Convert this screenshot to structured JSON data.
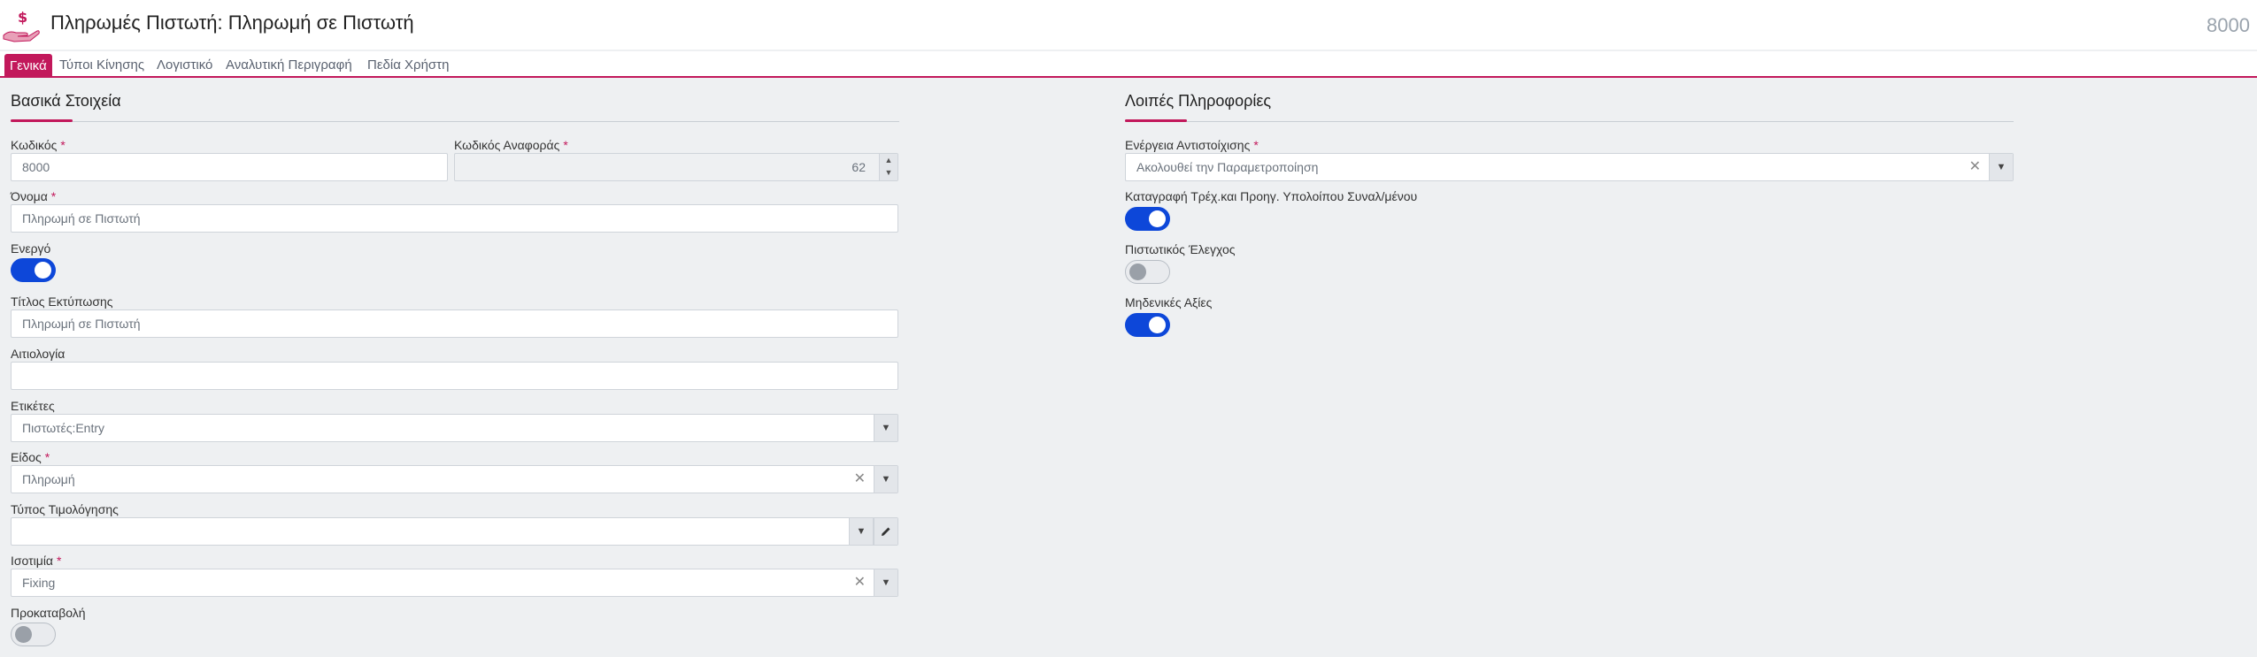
{
  "header": {
    "title": "Πληρωμές Πιστωτή: Πληρωμή σε Πιστωτή",
    "record_code": "8000",
    "icon": "hand-dollar-icon",
    "accent": "#c2185b"
  },
  "tabs": [
    {
      "label": "Γενικά",
      "active": true
    },
    {
      "label": "Τύποι Κίνησης",
      "active": false
    },
    {
      "label": "Λογιστικό",
      "active": false
    },
    {
      "label": "Αναλυτική Περιγραφή",
      "active": false
    },
    {
      "label": "Πεδία Χρήστη",
      "active": false
    }
  ],
  "basic": {
    "title": "Βασικά Στοιχεία",
    "code": {
      "label": "Κωδικός",
      "required": "*",
      "value": "8000"
    },
    "ref_code": {
      "label": "Κωδικός Αναφοράς",
      "required": "*",
      "value": "62"
    },
    "name": {
      "label": "Όνομα",
      "required": "*",
      "value": "Πληρωμή σε Πιστωτή"
    },
    "active": {
      "label": "Ενεργό",
      "on": true
    },
    "print_title": {
      "label": "Τίτλος Εκτύπωσης",
      "value": "Πληρωμή σε Πιστωτή"
    },
    "reason": {
      "label": "Αιτιολογία",
      "value": ""
    },
    "tags": {
      "label": "Ετικέτες",
      "value": "Πιστωτές:Entry"
    },
    "kind": {
      "label": "Είδος",
      "required": "*",
      "value": "Πληρωμή"
    },
    "invoice_type": {
      "label": "Τύπος Τιμολόγησης",
      "value": ""
    },
    "parity": {
      "label": "Ισοτιμία",
      "required": "*",
      "value": "Fixing"
    },
    "advance": {
      "label": "Προκαταβολή",
      "on": false
    }
  },
  "other": {
    "title": "Λοιπές Πληροφορίες",
    "match_action": {
      "label": "Ενέργεια Αντιστοίχισης",
      "required": "*",
      "value": "Ακολουθεί την Παραμετροποίηση"
    },
    "record_balance": {
      "label": "Καταγραφή Τρέχ.και Προηγ. Υπολοίπου Συναλ/μένου",
      "on": true
    },
    "credit_check": {
      "label": "Πιστωτικός Έλεγχος",
      "on": false
    },
    "zero_values": {
      "label": "Μηδενικές Αξίες",
      "on": true
    }
  }
}
